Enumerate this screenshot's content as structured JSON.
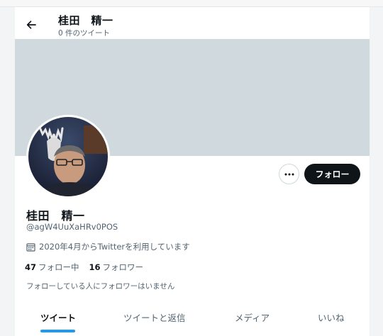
{
  "header": {
    "title": "桂田　精一",
    "subtitle": "0 件のツイート"
  },
  "profile": {
    "name": "桂田　精一",
    "handle": "@agW4UuXaHRv0POS",
    "joined": "2020年4月からTwitterを利用しています",
    "following_count": "47",
    "following_label": "フォロー中",
    "followers_count": "16",
    "followers_label": "フォロワー",
    "no_mutual_note": "フォローしている人にフォロワーはいません"
  },
  "actions": {
    "follow_label": "フォロー"
  },
  "tabs": [
    {
      "label": "ツイート",
      "active": true
    },
    {
      "label": "ツイートと返信",
      "active": false
    },
    {
      "label": "メディア",
      "active": false
    },
    {
      "label": "いいね",
      "active": false
    }
  ],
  "colors": {
    "banner": "#cfd9de",
    "accent": "#1d9bf0",
    "follow_button": "#0f1419",
    "secondary_text": "#536471"
  },
  "icons": {
    "back": "arrow-left-icon",
    "more": "more-horizontal-icon",
    "calendar": "calendar-icon"
  }
}
